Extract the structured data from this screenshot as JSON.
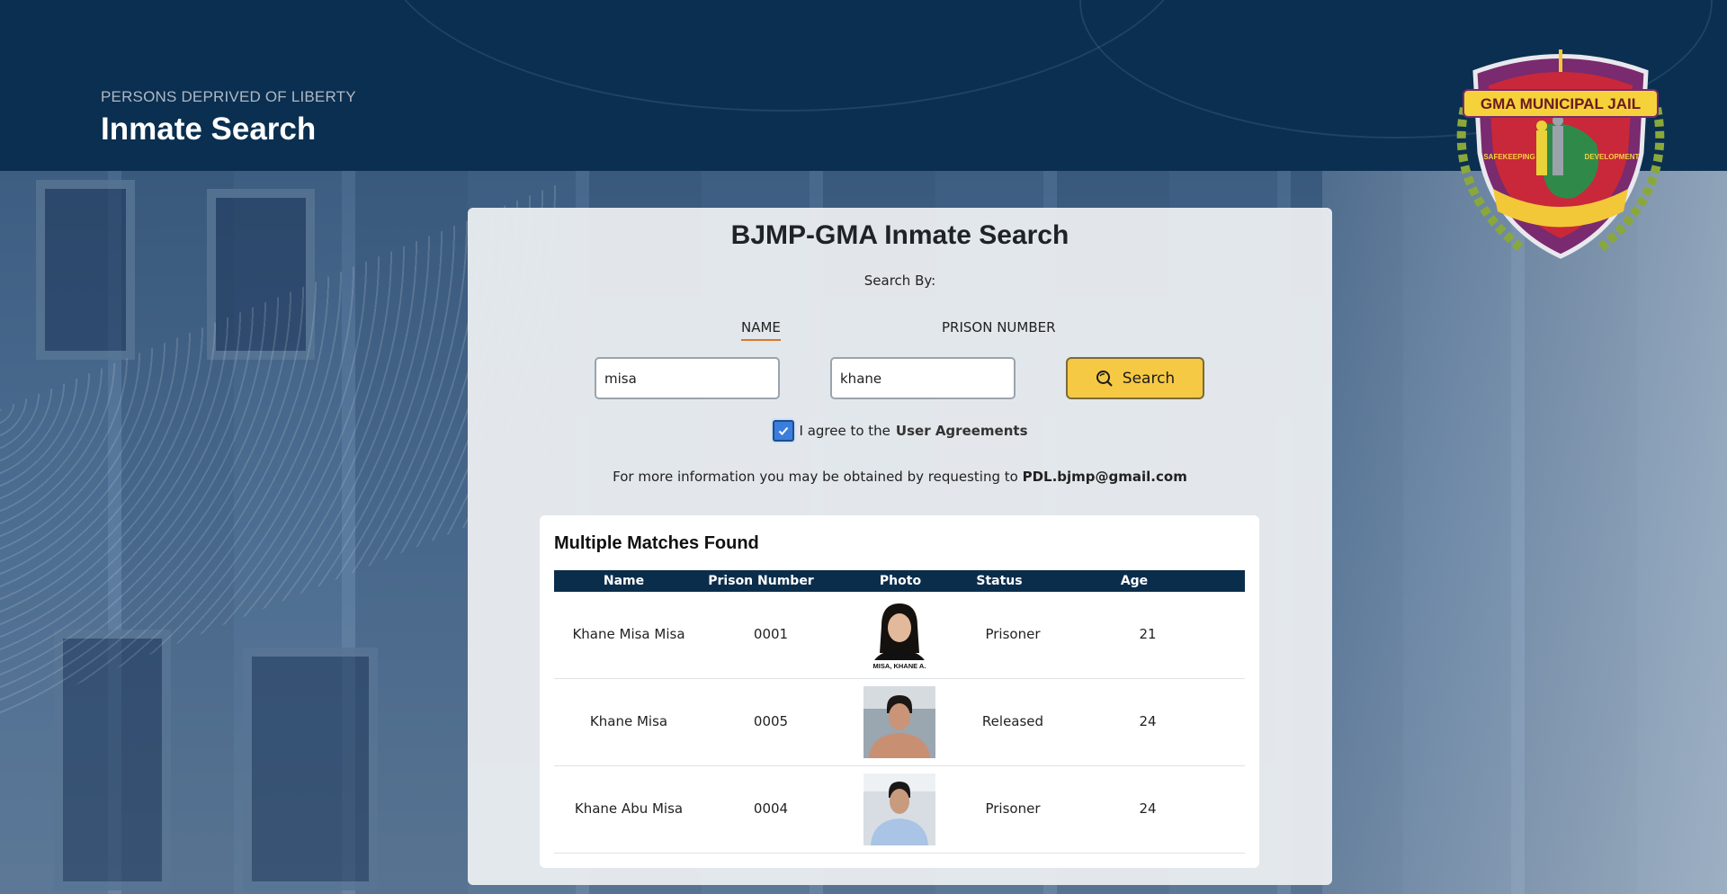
{
  "header": {
    "subtitle": "PERSONS DEPRIVED OF LIBERTY",
    "title": "Inmate Search"
  },
  "logo": {
    "banner_text": "GMA MUNICIPAL JAIL",
    "left_text": "SAFEKEEPING",
    "right_text": "DEVELOPMENT"
  },
  "card": {
    "title": "BJMP-GMA Inmate Search",
    "search_by_label": "Search By:",
    "tabs": [
      {
        "label": "NAME",
        "active": true
      },
      {
        "label": "PRISON NUMBER",
        "active": false
      }
    ],
    "first_input_value": "misa",
    "second_input_value": "khane",
    "search_button_label": "Search",
    "agree_prefix": "I agree to the",
    "agree_link": "User Agreements",
    "agreed": true,
    "info_prefix": "For more information you may be obtained by requesting to",
    "info_email": "PDL.bjmp@gmail.com"
  },
  "results": {
    "title": "Multiple Matches Found",
    "columns": [
      "Name",
      "Prison Number",
      "Photo",
      "Status",
      "Age"
    ],
    "rows": [
      {
        "name": "Khane Misa Misa",
        "prison_number": "0001",
        "photo_caption": "MISA, KHANE A.",
        "status": "Prisoner",
        "age": "21"
      },
      {
        "name": "Khane Misa",
        "prison_number": "0005",
        "photo_caption": "",
        "status": "Released",
        "age": "24"
      },
      {
        "name": "Khane Abu Misa",
        "prison_number": "0004",
        "photo_caption": "",
        "status": "Prisoner",
        "age": "24"
      }
    ]
  },
  "colors": {
    "header_bg": "#0a2f50",
    "accent_tab": "#d9782c",
    "search_button": "#f6c945",
    "table_header": "#0b2d4c"
  }
}
